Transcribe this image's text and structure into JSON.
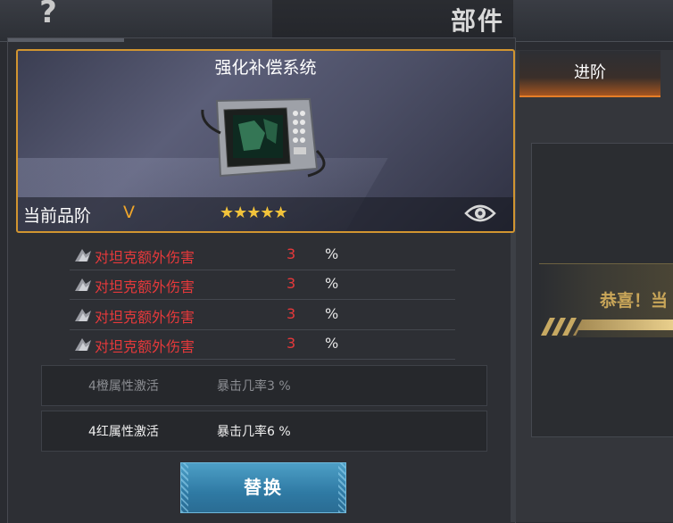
{
  "header": {
    "help_symbol": "?",
    "title": "部件"
  },
  "item": {
    "name": "强化补偿系统",
    "quality_label": "当前品阶",
    "quality_value": "V",
    "stars": "★★★★★",
    "star_count": 5,
    "border_color": "#d19530"
  },
  "stats": [
    {
      "name": "对坦克额外伤害",
      "value": "3",
      "unit": "%"
    },
    {
      "name": "对坦克额外伤害",
      "value": "3",
      "unit": "%"
    },
    {
      "name": "对坦克额外伤害",
      "value": "3",
      "unit": "%"
    },
    {
      "name": "对坦克额外伤害",
      "value": "3",
      "unit": "%"
    }
  ],
  "set_bonuses": [
    {
      "name": "4橙属性激活",
      "effect": "暴击几率3 %",
      "active": false
    },
    {
      "name": "4红属性激活",
      "effect": "暴击几率6 %",
      "active": true
    }
  ],
  "actions": {
    "replace_label": "替换"
  },
  "right_panel": {
    "tab_label": "进阶",
    "congrats_text": "恭喜！当"
  },
  "colors": {
    "stat_red": "#e5393b",
    "quality_orange": "#f0a62a",
    "star_gold": "#f2c33b",
    "button_blue": "#2f7aa4",
    "tab_orange": "#e57d28"
  }
}
